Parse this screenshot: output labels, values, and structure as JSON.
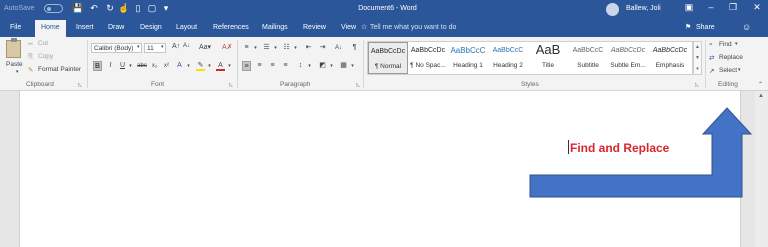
{
  "titlebar": {
    "autosave": "AutoSave",
    "autosave_state": "Off",
    "title": "Document6 - Word",
    "user": "Ballew, Joli",
    "qat_icons": [
      "save-icon",
      "undo-icon",
      "redo-icon",
      "touch-mode-icon",
      "new-document-icon",
      "open-icon",
      "customize-qat-icon"
    ]
  },
  "tabs": [
    "File",
    "Home",
    "Insert",
    "Draw",
    "Design",
    "Layout",
    "References",
    "Mailings",
    "Review",
    "View"
  ],
  "active_tab": "Home",
  "tellme": "Tell me what you want to do",
  "share": "Share",
  "clipboard": {
    "paste": "Paste",
    "cut": "Cut",
    "copy": "Copy",
    "format_painter": "Format Painter",
    "label": "Clipboard"
  },
  "font": {
    "name": "Calibri (Body)",
    "size": "11",
    "label": "Font"
  },
  "paragraph": {
    "label": "Paragraph"
  },
  "styles": {
    "label": "Styles",
    "items": [
      {
        "sample": "AaBbCcDc",
        "name": "¶ Normal"
      },
      {
        "sample": "AaBbCcDc",
        "name": "¶ No Spac..."
      },
      {
        "sample": "AaBbCcC",
        "name": "Heading 1"
      },
      {
        "sample": "AaBbCcC",
        "name": "Heading 2"
      },
      {
        "sample": "AaB",
        "name": "Title"
      },
      {
        "sample": "AaBbCcC",
        "name": "Subtitle"
      },
      {
        "sample": "AaBbCcDc",
        "name": "Subtle Em..."
      },
      {
        "sample": "AaBbCcDc",
        "name": "Emphasis"
      }
    ]
  },
  "editing": {
    "find": "Find",
    "replace": "Replace",
    "select": "Select",
    "label": "Editing"
  },
  "document": {
    "text": "Find and Replace"
  },
  "colors": {
    "brand": "#2b579a",
    "arrow": "#4472c4",
    "text_red": "#d9262e"
  }
}
